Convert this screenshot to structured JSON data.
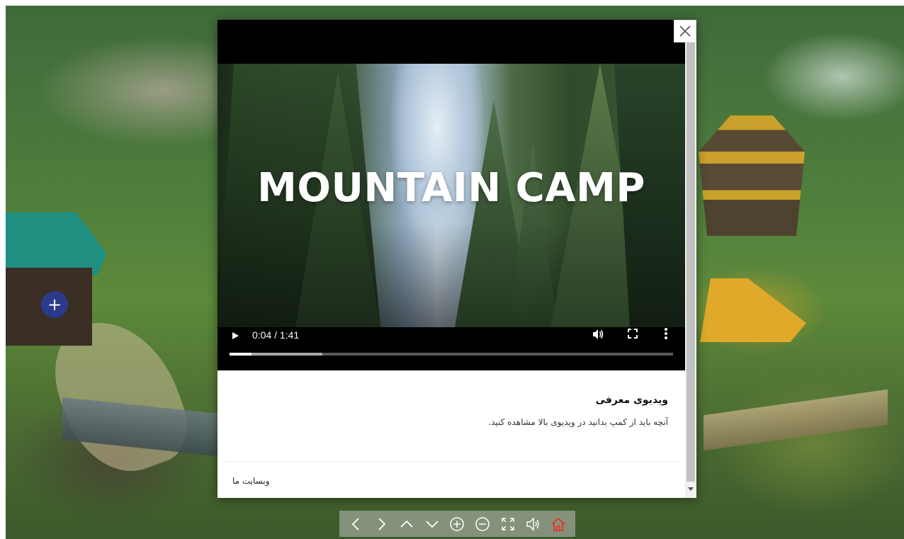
{
  "video": {
    "title": "MOUNTAIN CAMP",
    "time": "0:04 / 1:41",
    "progress_played": 0.05,
    "progress_buffered": 0.21
  },
  "info": {
    "title": "ویدیوی معرفی",
    "description": "آنچه باید از کمپ بدانید در ویدیوی بالا مشاهده کنید."
  },
  "footer": {
    "website_link": "وبسایت ما"
  },
  "hotspot": {
    "label": "+"
  },
  "icons": {
    "close": "close-icon",
    "play": "play-icon",
    "volume": "volume-icon",
    "fullscreen": "fullscreen-icon",
    "more": "more-vertical-icon",
    "nav": [
      "chevron-left-icon",
      "chevron-right-icon",
      "chevron-up-icon",
      "chevron-down-icon",
      "zoom-in-icon",
      "zoom-out-icon",
      "fullscreen-icon",
      "sound-icon",
      "home-icon"
    ]
  },
  "colors": {
    "hotspot": "#2c3a8c",
    "home_icon": "#e03c2e",
    "nav_icon": "#ffffff"
  }
}
